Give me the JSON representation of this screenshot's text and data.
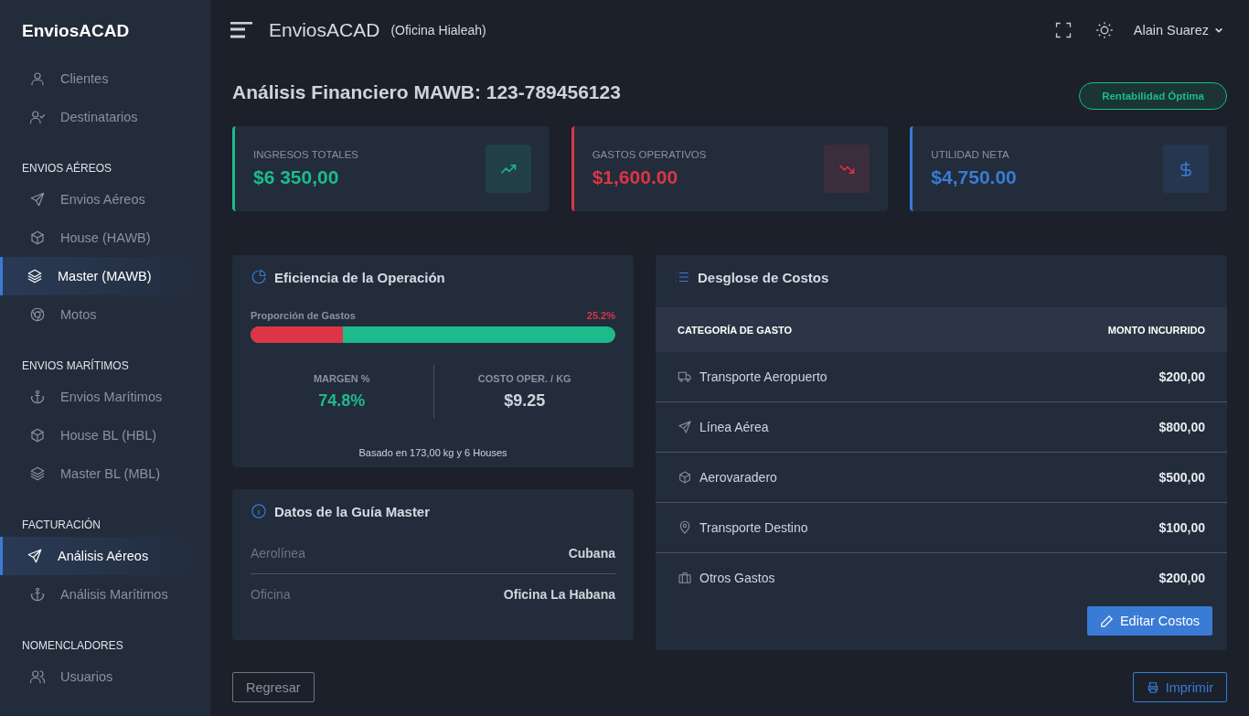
{
  "brand": "EnviosACAD",
  "sidebar": {
    "sections": [
      {
        "items": [
          {
            "label": "Clientes",
            "kind": "user",
            "selected": false
          },
          {
            "label": "Destinatarios",
            "kind": "user-check",
            "selected": false
          }
        ]
      },
      {
        "heading": "ENVIOS AÉREOS",
        "items": [
          {
            "label": "Envios Aéreos",
            "kind": "send",
            "selected": false
          },
          {
            "label": "House (HAWB)",
            "kind": "box",
            "selected": false
          },
          {
            "label": "Master (MAWB)",
            "kind": "layers",
            "selected": true
          },
          {
            "label": "Motos",
            "kind": "wheel",
            "selected": false
          }
        ]
      },
      {
        "heading": "ENVIOS MARÍTIMOS",
        "items": [
          {
            "label": "Envios Marítimos",
            "kind": "anchor",
            "selected": false
          },
          {
            "label": "House BL (HBL)",
            "kind": "box",
            "selected": false
          },
          {
            "label": "Master BL (MBL)",
            "kind": "layers",
            "selected": false
          }
        ]
      },
      {
        "heading": "FACTURACIÓN",
        "items": [
          {
            "label": "Análisis Aéreos",
            "kind": "send",
            "selected": true
          },
          {
            "label": "Análisis Marítimos",
            "kind": "anchor",
            "selected": false
          }
        ]
      },
      {
        "heading": "NOMENCLADORES",
        "items": [
          {
            "label": "Usuarios",
            "kind": "users",
            "selected": false
          }
        ]
      }
    ]
  },
  "header": {
    "title": "EnviosACAD",
    "office": "(Oficina Hialeah)",
    "user": "Alain Suarez"
  },
  "page": {
    "title": "Análisis Financiero MAWB: 123-789456123",
    "badge": "Rentabilidad Óptima"
  },
  "stats": [
    {
      "label": "INGRESOS TOTALES",
      "value": "$6 350,00",
      "color": "#1dbb8c",
      "kind": "trend-up"
    },
    {
      "label": "GASTOS OPERATIVOS",
      "value": "$1,600.00",
      "color": "#dc3545",
      "kind": "trend-down"
    },
    {
      "label": "UTILIDAD NETA",
      "value": "$4,750.00",
      "color": "#3a7bd5",
      "kind": "dollar"
    }
  ],
  "efficiency": {
    "title": "Eficiencia de la Operación",
    "bar_label": "Proporción de Gastos",
    "bar_reading": "25.2%",
    "level": 0.252,
    "metrics": [
      {
        "label": "MARGEN %",
        "value": "74.8%",
        "kind": "positive"
      },
      {
        "label": "COSTO OPER. / KG",
        "value": "$9.25",
        "kind": "neutral"
      }
    ],
    "note": "Basado en 173,00 kg y 6 Houses"
  },
  "guide": {
    "title": "Datos de la Guía Master",
    "rows": [
      {
        "label": "Aerolínea",
        "value": "Cubana"
      },
      {
        "label": "Oficina",
        "value": "Oficina La Habana"
      }
    ]
  },
  "costs": {
    "title": "Desglose de Costos",
    "columns": [
      "CATEGORÍA DE GASTO",
      "MONTO INCURRIDO"
    ],
    "rows": [
      {
        "category": "Transporte Aeropuerto",
        "amount": "$200,00",
        "kind": "truck"
      },
      {
        "category": "Línea Aérea",
        "amount": "$800,00",
        "kind": "send"
      },
      {
        "category": "Aerovaradero",
        "amount": "$500,00",
        "kind": "box"
      },
      {
        "category": "Transporte Destino",
        "amount": "$100,00",
        "kind": "pin"
      },
      {
        "category": "Otros Gastos",
        "amount": "$200,00",
        "kind": "briefcase"
      }
    ],
    "edit_button": "Editar Costos"
  },
  "buttons": {
    "back": "Regresar",
    "print": "Imprimir"
  }
}
